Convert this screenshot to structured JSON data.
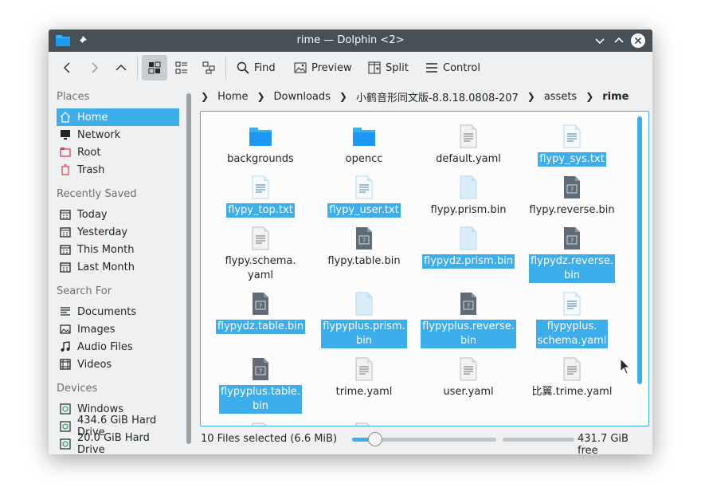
{
  "window": {
    "title": "rime — Dolphin <2>"
  },
  "colors": {
    "accent": "#3daee9",
    "titlebar": "#475057",
    "window_bg": "#eff0f1",
    "view_bg": "#fcfcfc"
  },
  "toolbar": {
    "back_icon": "chevron-left-icon",
    "forward_icon": "chevron-right-icon",
    "up_icon": "chevron-up-icon",
    "view_modes": [
      "icons-view",
      "compact-view",
      "details-view"
    ],
    "find_label": "Find",
    "preview_label": "Preview",
    "split_label": "Split",
    "control_label": "Control"
  },
  "sidebar": {
    "places_heading": "Places",
    "places": [
      {
        "label": "Home",
        "icon": "home-icon",
        "selected": true
      },
      {
        "label": "Network",
        "icon": "network-icon"
      },
      {
        "label": "Root",
        "icon": "root-folder-icon"
      },
      {
        "label": "Trash",
        "icon": "trash-icon"
      }
    ],
    "recent_heading": "Recently Saved",
    "recent": [
      {
        "label": "Today",
        "icon": "calendar-icon"
      },
      {
        "label": "Yesterday",
        "icon": "calendar-icon"
      },
      {
        "label": "This Month",
        "icon": "calendar-icon"
      },
      {
        "label": "Last Month",
        "icon": "calendar-icon"
      }
    ],
    "search_heading": "Search For",
    "search": [
      {
        "label": "Documents",
        "icon": "document-icon"
      },
      {
        "label": "Images",
        "icon": "image-icon"
      },
      {
        "label": "Audio Files",
        "icon": "music-icon"
      },
      {
        "label": "Videos",
        "icon": "video-icon"
      }
    ],
    "devices_heading": "Devices",
    "devices": [
      {
        "label": "Windows",
        "icon": "drive-icon"
      },
      {
        "label": "434.6 GiB Hard Drive",
        "icon": "drive-icon"
      },
      {
        "label": "20.0 GiB Hard Drive",
        "icon": "drive-icon"
      }
    ]
  },
  "breadcrumb": {
    "items": [
      "Home",
      "Downloads",
      "小鹤音形同文版-8.8.18.0808-207",
      "assets",
      "rime"
    ]
  },
  "files": [
    {
      "name": "backgrounds",
      "type": "folder",
      "selected": false
    },
    {
      "name": "opencc",
      "type": "folder",
      "selected": false
    },
    {
      "name": "default.yaml",
      "type": "text",
      "selected": false
    },
    {
      "name": "flypy_sys.txt",
      "type": "plain",
      "selected": true
    },
    {
      "name": "flypy_top.txt",
      "type": "plain",
      "selected": true
    },
    {
      "name": "flypy_user.txt",
      "type": "plain",
      "selected": true
    },
    {
      "name": "flypy.prism.bin",
      "type": "blank",
      "selected": false
    },
    {
      "name": "flypy.reverse.bin",
      "type": "binary",
      "selected": false
    },
    {
      "name": "flypy.schema.\nyaml",
      "type": "text",
      "selected": false
    },
    {
      "name": "flypy.table.bin",
      "type": "binary",
      "selected": false
    },
    {
      "name": "flypydz.prism.bin",
      "type": "blank",
      "selected": true
    },
    {
      "name": "flypydz.reverse.\nbin",
      "type": "binary",
      "selected": true
    },
    {
      "name": "flypydz.table.bin",
      "type": "binary",
      "selected": true
    },
    {
      "name": "flypyplus.prism.\nbin",
      "type": "blank",
      "selected": true
    },
    {
      "name": "flypyplus.reverse.\nbin",
      "type": "binary",
      "selected": true
    },
    {
      "name": "flypyplus.\nschema.yaml",
      "type": "plain",
      "selected": true
    },
    {
      "name": "flypyplus.table.\nbin",
      "type": "binary",
      "selected": true
    },
    {
      "name": "trime.yaml",
      "type": "text",
      "selected": false
    },
    {
      "name": "user.yaml",
      "type": "text",
      "selected": false
    },
    {
      "name": "比翼.trime.yaml",
      "type": "text",
      "selected": false
    }
  ],
  "statusbar": {
    "selection_text": "10 Files selected (6.6 MiB)",
    "zoom_level": 0.16,
    "free_space_text": "431.7 GiB free"
  }
}
